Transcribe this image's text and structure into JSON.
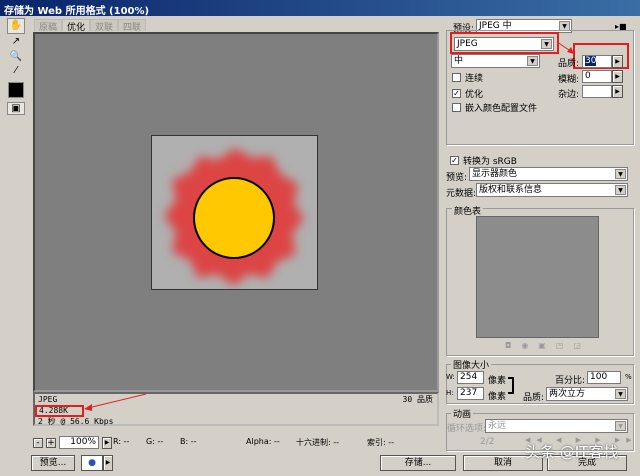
{
  "title": "存储为 Web 所用格式 (100%)",
  "tabs": [
    "原稿",
    "优化",
    "双联",
    "四联"
  ],
  "preset": {
    "label": "预设:",
    "value": "JPEG 中"
  },
  "format": "JPEG",
  "quality_preset": "中",
  "quality": {
    "label": "品质:",
    "value": "30"
  },
  "blur": {
    "label": "模糊:",
    "value": "0"
  },
  "matte": {
    "label": "杂边:"
  },
  "checkboxes": [
    {
      "label": "连续",
      "checked": false
    },
    {
      "label": "优化",
      "checked": true
    },
    {
      "label": "嵌入颜色配置文件",
      "checked": false
    }
  ],
  "convert_srgb": {
    "label": "转换为 sRGB",
    "checked": true
  },
  "preview_sel": {
    "label": "预览:",
    "value": "显示器颜色"
  },
  "metadata": {
    "label": "元数据:",
    "value": "版权和联系信息"
  },
  "color_table": {
    "label": "颜色表"
  },
  "image_size": {
    "label": "图像大小",
    "w_label": "W:",
    "w": "254",
    "h_label": "H:",
    "h": "237",
    "unit": "像素",
    "percent_label": "百分比:",
    "percent": "100",
    "percent_unit": "%",
    "quality_label": "品质:",
    "quality": "两次立方"
  },
  "animation": {
    "label": "动画",
    "loop_label": "循环选项:",
    "loop": "永远",
    "frame": "2/2"
  },
  "info": {
    "format": "JPEG",
    "size": "4.288K",
    "time": "2 秒 @ 56.6 Kbps",
    "quality": "30 品质"
  },
  "status": {
    "zoom": "100%",
    "r": "R: --",
    "g": "G: --",
    "b": "B: --",
    "alpha": "Alpha: --",
    "hex": "十六进制: --",
    "index": "索引: --"
  },
  "buttons": {
    "preview": "预览...",
    "save": "存储...",
    "cancel": "取消",
    "done": "完成"
  },
  "watermark": "头条 @IT客栈"
}
